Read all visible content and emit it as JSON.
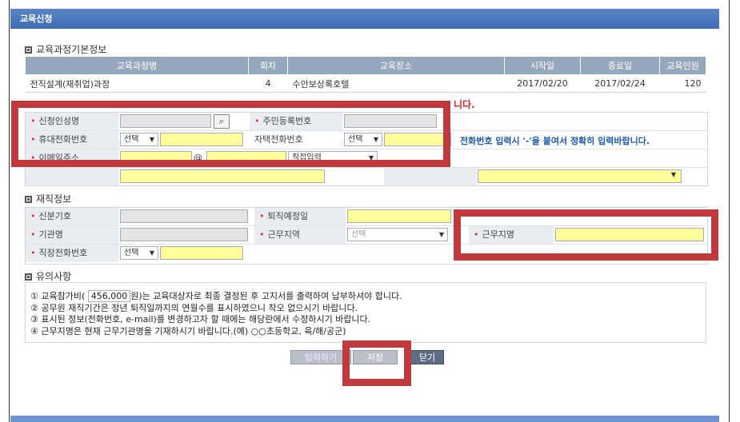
{
  "window": {
    "title": "교육신청"
  },
  "course_info": {
    "section_title": "교육과정기본정보",
    "headers": [
      "교육과정명",
      "회차",
      "교육장소",
      "시작일",
      "종료일",
      "교육인원"
    ],
    "row": [
      "전직설계(재취업)과정",
      "4",
      "수안보상록호텔",
      "2017/02/20",
      "2017/02/24",
      "120"
    ]
  },
  "partial_notice": "니다.",
  "applicant": {
    "name_label": "신청인성명",
    "rrn_label": "주민등록번호",
    "mobile_label": "휴대전화번호",
    "home_phone_label": "자택전화번호",
    "email_label": "이메일주소",
    "select_label": "선택",
    "at": "@",
    "email_domain_option": "직접입력",
    "phone_hint": "전화번호 입력시 '-'을 붙여서 정확히 입력바랍니다."
  },
  "employment": {
    "section_title": "재직정보",
    "id_label": "신분기호",
    "retire_label": "퇴직예정일",
    "org_label": "기관명",
    "region_label": "근무지역",
    "region_value": "선택",
    "workplace_label": "근무지명",
    "office_phone_label": "직장전화번호",
    "select_label": "선택"
  },
  "notes": {
    "section_title": "유의사항",
    "line1_prefix": "① 교육참가비(",
    "fee": "456,000",
    "line1_suffix": "원)는 교육대상자로 최종 결정된 후 고지서를 출력하여 납부하셔야 합니다.",
    "line2": "② 공무원 재직기간은 정년 퇴직일까지의 연월수를 표시하였으니 착오 없으시기 바랍니다.",
    "line3": "③ 표시된 정보(전화번호, e-mail)를 변경하고자 할 때에는 해당란에서 수정하시기 바랍니다.",
    "line4": "④ 근무지명은 현재 근무기관명을 기재하시기 바랍니다.(예) ○○초등학교, 육/해/공군)"
  },
  "buttons": {
    "reset": "입력하기",
    "save": "저장",
    "close": "닫기"
  },
  "colors": {
    "highlight": "#c0393d",
    "titlebar": "#4a76bc",
    "required_field": "#ffff99"
  }
}
